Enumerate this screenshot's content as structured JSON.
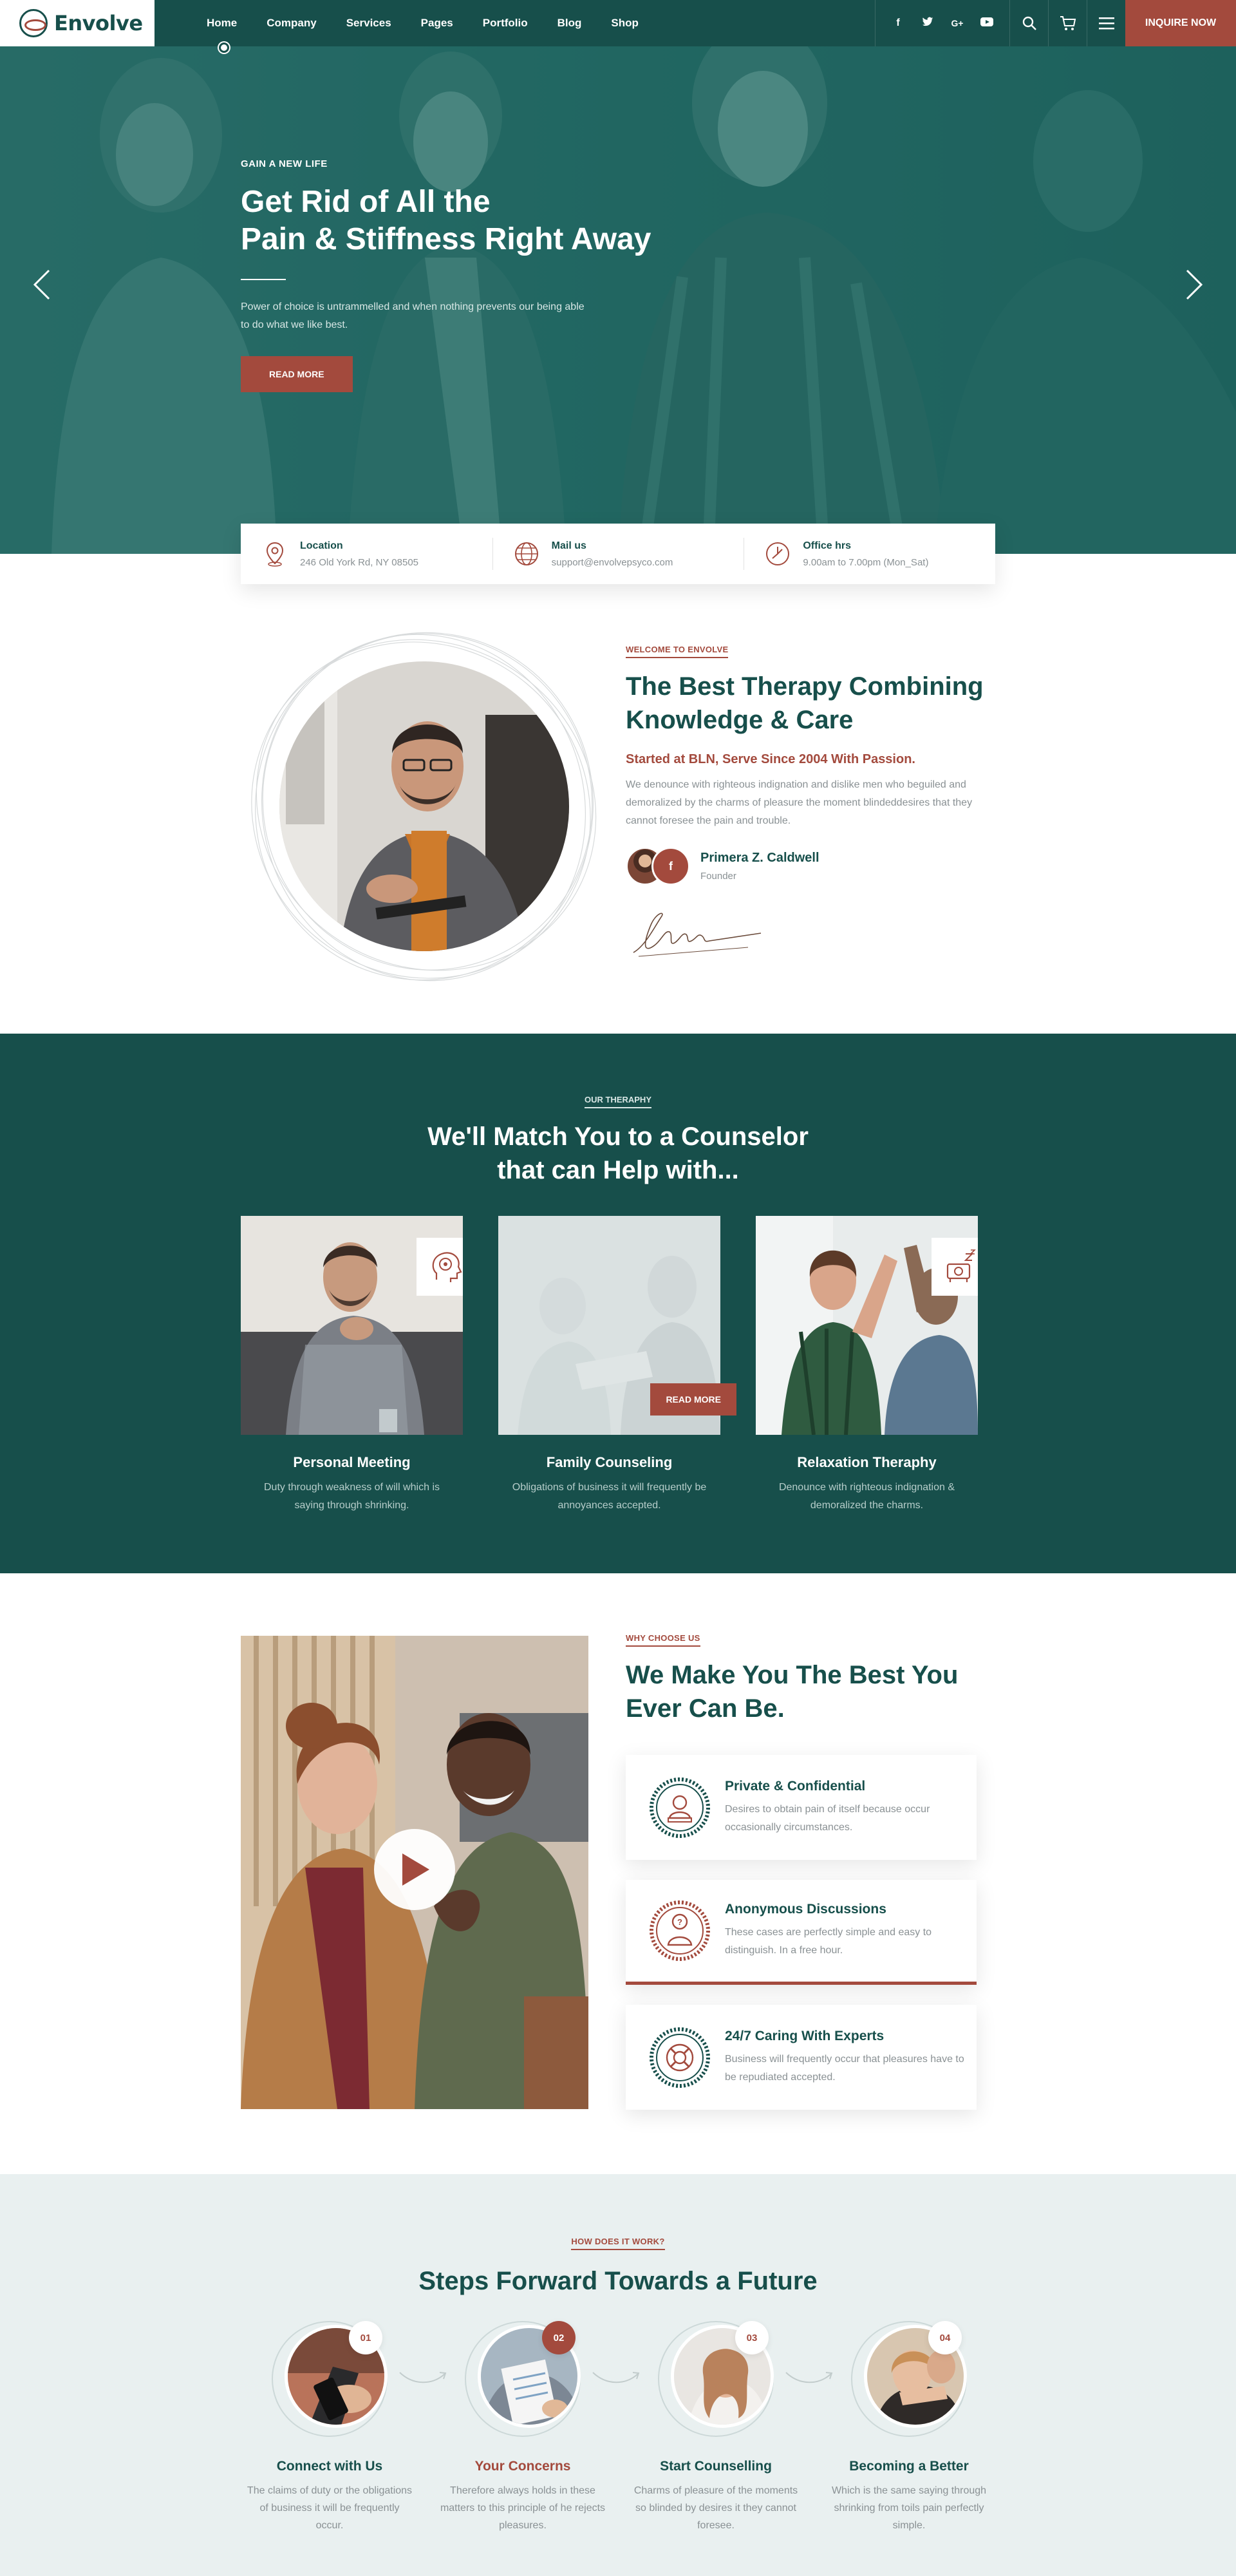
{
  "brand": {
    "name": "Envolve"
  },
  "nav": {
    "items": [
      "Home",
      "Company",
      "Services",
      "Pages",
      "Portfolio",
      "Blog",
      "Shop"
    ],
    "active": "Home"
  },
  "socials": [
    "f",
    "t",
    "G+",
    "yt"
  ],
  "header": {
    "inquire_label": "INQUIRE NOW"
  },
  "hero": {
    "eyebrow": "GAIN A NEW LIFE",
    "title_line1": "Get Rid of All the",
    "title_line2": "Pain & Stiffness Right Away",
    "text": "Power of choice is untrammelled and when nothing prevents our being able to do what we like best.",
    "button": "READ MORE"
  },
  "info": [
    {
      "title": "Location",
      "value": "246 Old York Rd, NY 08505",
      "icon": "location-pin-icon"
    },
    {
      "title": "Mail us",
      "value": "support@envolvepsyco.com",
      "icon": "globe-icon"
    },
    {
      "title": "Office hrs",
      "value": "9.00am to 7.00pm (Mon_Sat)",
      "icon": "clock-icon"
    }
  ],
  "about": {
    "eyebrow": "WELCOME TO ENVOLVE",
    "title_line1": "The Best Therapy Combining",
    "title_line2": "Knowledge & Care",
    "subtitle": "Started at BLN, Serve Since 2004 With Passion.",
    "text": "We denounce with righteous indignation and dislike men who  beguiled and demoralized by the charms of pleasure the moment blindeddesires that they cannot foresee the pain and trouble.",
    "founder_name": "Primera Z. Caldwell",
    "founder_role": "Founder",
    "founder_social": "f"
  },
  "therapy": {
    "eyebrow": "OUR THERAPHY",
    "title_line1": "We'll Match You to a Counselor",
    "title_line2": "that can Help with...",
    "cards": [
      {
        "name": "Personal Meeting",
        "desc": "Duty through weakness of will which is saying through shrinking.",
        "icon": "head-mind-icon"
      },
      {
        "name": "Family Counseling",
        "desc": "Obligations of business it will frequently be annoyances accepted.",
        "button": "READ MORE"
      },
      {
        "name": "Relaxation Theraphy",
        "desc": "Denounce with righteous indignation & demoralized the charms.",
        "icon": "sleep-icon"
      }
    ]
  },
  "why": {
    "eyebrow": "WHY CHOOSE US",
    "title_line1": "We Make You The Best You",
    "title_line2": "Ever Can Be.",
    "features": [
      {
        "title": "Private & Confidential",
        "text": "Desires to obtain pain of itself because occur occasionally circumstances.",
        "icon": "person-badge-icon"
      },
      {
        "title": "Anonymous Discussions",
        "text": "These cases are perfectly simple and easy to distinguish. In a free hour.",
        "icon": "question-person-icon"
      },
      {
        "title": "24/7 Caring With Experts",
        "text": "Business will frequently occur that pleasures have to be repudiated accepted.",
        "icon": "lifebuoy-icon"
      }
    ]
  },
  "steps": {
    "eyebrow": "HOW DOES IT WORK?",
    "title": "Steps Forward Towards a Future",
    "items": [
      {
        "num": "01",
        "name": "Connect with Us",
        "desc": "The claims of duty or the obligations of business it will be frequently occur."
      },
      {
        "num": "02",
        "name": "Your Concerns",
        "desc": "Therefore always holds in these matters to this principle of he rejects pleasures."
      },
      {
        "num": "03",
        "name": "Start Counselling",
        "desc": "Charms of pleasure of the moments so blinded by desires it they cannot foresee."
      },
      {
        "num": "04",
        "name": "Becoming a Better",
        "desc": "Which is the same saying through shrinking from toils pain perfectly simple."
      }
    ]
  },
  "colors": {
    "primary": "#174f4b",
    "accent": "#a34a3d",
    "light_bg": "#e9f0f0"
  }
}
